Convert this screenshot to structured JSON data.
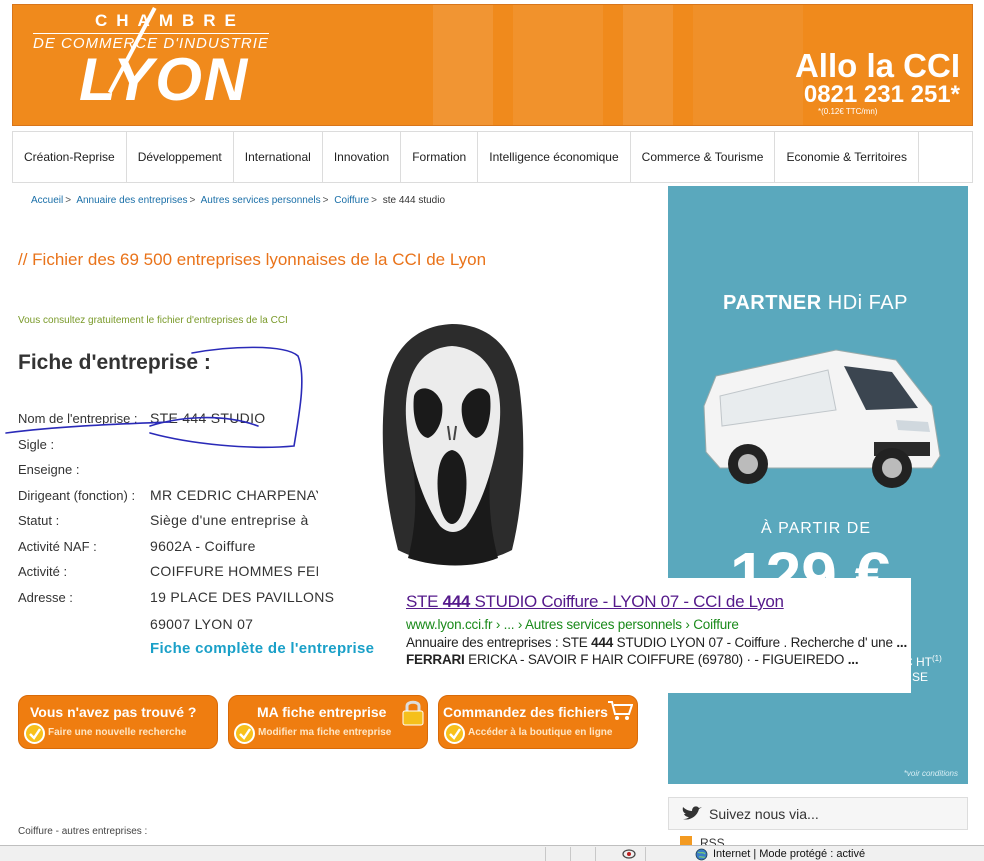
{
  "header": {
    "logo_line1": "CHAMBRE",
    "logo_line2": "DE COMMERCE D'INDUSTRIE",
    "logo_line3": "LYON",
    "allo_title": "Allo la CCI",
    "allo_phone": "0821 231 251*",
    "allo_note": "*(0.12€ TTC/mn)"
  },
  "nav": [
    "Création-Reprise",
    "Développement",
    "International",
    "Innovation",
    "Formation",
    "Intelligence économique",
    "Commerce & Tourisme",
    "Economie & Territoires"
  ],
  "breadcrumb": {
    "links": [
      "Accueil",
      "Annuaire des entreprises",
      "Autres services personnels",
      "Coiffure"
    ],
    "separator": ">",
    "current": "ste 444 studio"
  },
  "main": {
    "heading": "// Fichier des 69 500 entreprises lyonnaises de la CCI de Lyon",
    "note": "Vous consultez gratuitement le fichier d'entreprises de la CCI",
    "fiche_title": "Fiche d'entreprise :",
    "full_link": "Fiche complète de l'entreprise"
  },
  "fields": [
    {
      "label": "Nom de l'entreprise :",
      "value": "STE 444 STUDIO"
    },
    {
      "label": "Sigle :",
      "value": ""
    },
    {
      "label": "Enseigne :",
      "value": ""
    },
    {
      "label": "Dirigeant (fonction) :",
      "value": "MR CEDRIC CHARPENAY"
    },
    {
      "label": "Statut :",
      "value": "Siège d'une entreprise à"
    },
    {
      "label": "Activité NAF :",
      "value": "9602A - Coiffure"
    },
    {
      "label": "Activité :",
      "value": "COIFFURE HOMMES FEMMES"
    },
    {
      "label": "Adresse :",
      "value": "19 PLACE DES PAVILLONS"
    },
    {
      "label": "",
      "value": "69007 LYON 07"
    }
  ],
  "ad": {
    "title_bold": "PARTNER",
    "title_thin": "HDi FAP",
    "sub": "À PARTIR DE",
    "price": "129 €",
    "ht": "C HT",
    "ht_sup": "(1)",
    "se": "SE",
    "conditions": "*voir conditions"
  },
  "search_result": {
    "title_pre": "STE ",
    "title_bold": "444",
    "title_post": " STUDIO Coiffure - LYON 07 - CCI de Lyon",
    "url": "www.lyon.cci.fr › ... › Autres services personnels › Coiffure",
    "snippet1_pre": "Annuaire des entreprises : STE ",
    "snippet1_bold": "444",
    "snippet1_post": " STUDIO LYON 07 - Coiffure . Recherche d' une ",
    "snippet1_end": "...",
    "snippet2_bold": "FERRARI",
    "snippet2_post": " ERICKA - SAVOIR F HAIR COIFFURE (69780) · - FIGUEIREDO ",
    "snippet2_end": "..."
  },
  "buttons": [
    {
      "title": "Vous n'avez pas trouvé ?",
      "sub": "Faire une nouvelle recherche",
      "icon": "check-icon"
    },
    {
      "title": "MA fiche entreprise",
      "sub": "Modifier ma fiche entreprise",
      "icon": "lock-icon"
    },
    {
      "title": "Commandez des fichiers",
      "sub": "Accéder à la boutique en ligne",
      "icon": "cart-icon"
    }
  ],
  "other_companies": "Coiffure - autres entreprises :",
  "follow": {
    "label": "Suivez nous via...",
    "rss": "RSS"
  },
  "statusbar": {
    "text": "Internet | Mode protégé : activé"
  },
  "colors": {
    "accent": "#f08a1c",
    "link": "#1a6fa8",
    "ad_bg": "#5aa8bd",
    "result_title": "#551a8b",
    "result_url": "#1a8a1a",
    "annotation": "#2a2ab8"
  }
}
